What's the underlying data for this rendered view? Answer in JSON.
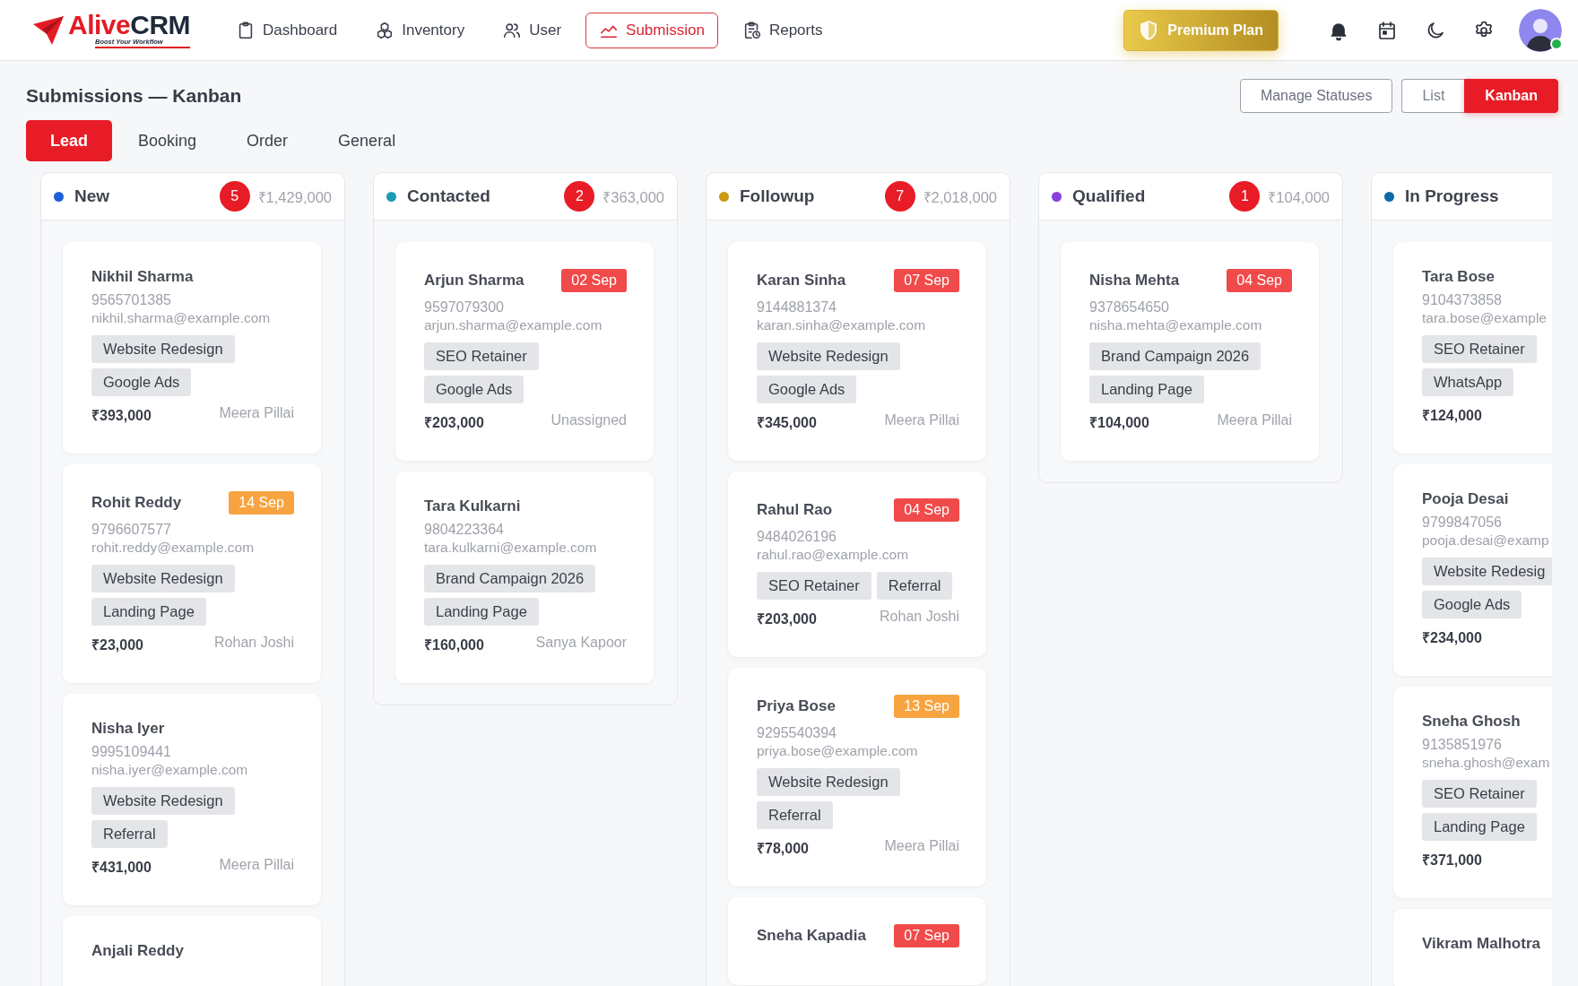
{
  "header": {
    "brand_first": "Alive",
    "brand_second": "CRM",
    "tagline": "Boost Your Workflow",
    "nav": [
      {
        "label": "Dashboard",
        "selected": false
      },
      {
        "label": "Inventory",
        "selected": false
      },
      {
        "label": "User",
        "selected": false
      },
      {
        "label": "Submission",
        "selected": true
      },
      {
        "label": "Reports",
        "selected": false
      }
    ],
    "premium": "Premium Plan",
    "user_online": true
  },
  "page": {
    "title": "Submissions — Kanban",
    "manage_button": "Manage Statuses",
    "views": [
      {
        "label": "List",
        "selected": false
      },
      {
        "label": "Kanban",
        "selected": true
      }
    ],
    "tabs": [
      {
        "label": "Lead",
        "selected": true
      },
      {
        "label": "Booking",
        "selected": false
      },
      {
        "label": "Order",
        "selected": false
      },
      {
        "label": "General",
        "selected": false
      }
    ]
  },
  "columns": [
    {
      "name": "New",
      "color": "#1f5fd8",
      "count": "5",
      "total": "₹1,429,000",
      "cards": [
        {
          "name": "Nikhil Sharma",
          "phone": "9565701385",
          "email": "nikhil.sharma@example.com",
          "tags": [
            "Website Redesign",
            "Google Ads"
          ],
          "amount": "₹393,000",
          "assignee": "Meera Pillai"
        },
        {
          "name": "Rohit Reddy",
          "due": {
            "label": "14 Sep",
            "color": "#f7a440"
          },
          "phone": "9796607577",
          "email": "rohit.reddy@example.com",
          "tags": [
            "Website Redesign",
            "Landing Page"
          ],
          "amount": "₹23,000",
          "assignee": "Rohan Joshi"
        },
        {
          "name": "Nisha Iyer",
          "phone": "9995109441",
          "email": "nisha.iyer@example.com",
          "tags": [
            "Website Redesign",
            "Referral"
          ],
          "amount": "₹431,000",
          "assignee": "Meera Pillai"
        },
        {
          "name": "Anjali Reddy"
        }
      ]
    },
    {
      "name": "Contacted",
      "color": "#1c9cb4",
      "count": "2",
      "total": "₹363,000",
      "cards": [
        {
          "name": "Arjun Sharma",
          "due": {
            "label": "02 Sep",
            "color": "#f04a4a"
          },
          "phone": "9597079300",
          "email": "arjun.sharma@example.com",
          "tags": [
            "SEO Retainer",
            "Google Ads"
          ],
          "amount": "₹203,000",
          "assignee": "Unassigned"
        },
        {
          "name": "Tara Kulkarni",
          "phone": "9804223364",
          "email": "tara.kulkarni@example.com",
          "tags": [
            "Brand Campaign 2026",
            "Landing Page"
          ],
          "amount": "₹160,000",
          "assignee": "Sanya Kapoor"
        }
      ]
    },
    {
      "name": "Followup",
      "color": "#c99a12",
      "count": "7",
      "total": "₹2,018,000",
      "cards": [
        {
          "name": "Karan Sinha",
          "due": {
            "label": "07 Sep",
            "color": "#f04a4a"
          },
          "phone": "9144881374",
          "email": "karan.sinha@example.com",
          "tags": [
            "Website Redesign",
            "Google Ads"
          ],
          "amount": "₹345,000",
          "assignee": "Meera Pillai"
        },
        {
          "name": "Rahul Rao",
          "due": {
            "label": "04 Sep",
            "color": "#f04a4a"
          },
          "phone": "9484026196",
          "email": "rahul.rao@example.com",
          "tags": [
            "SEO Retainer",
            "Referral"
          ],
          "amount": "₹203,000",
          "assignee": "Rohan Joshi"
        },
        {
          "name": "Priya Bose",
          "due": {
            "label": "13 Sep",
            "color": "#f7a440"
          },
          "phone": "9295540394",
          "email": "priya.bose@example.com",
          "tags": [
            "Website Redesign",
            "Referral"
          ],
          "amount": "₹78,000",
          "assignee": "Meera Pillai"
        },
        {
          "name": "Sneha Kapadia",
          "due": {
            "label": "07 Sep",
            "color": "#f04a4a"
          }
        }
      ]
    },
    {
      "name": "Qualified",
      "color": "#8a3fe0",
      "count": "1",
      "total": "₹104,000",
      "cards": [
        {
          "name": "Nisha Mehta",
          "due": {
            "label": "04 Sep",
            "color": "#f04a4a"
          },
          "phone": "9378654650",
          "email": "nisha.mehta@example.com",
          "tags": [
            "Brand Campaign 2026",
            "Landing Page"
          ],
          "amount": "₹104,000",
          "assignee": "Meera Pillai"
        }
      ]
    },
    {
      "name": "In Progress",
      "color": "#0e69a8",
      "cards": [
        {
          "name": "Tara Bose",
          "phone": "9104373858",
          "email": "tara.bose@example",
          "tags": [
            "SEO Retainer",
            "WhatsApp"
          ],
          "amount": "₹124,000"
        },
        {
          "name": "Pooja Desai",
          "phone": "9799847056",
          "email": "pooja.desai@examp",
          "tags": [
            "Website Redesig",
            "Google Ads"
          ],
          "amount": "₹234,000"
        },
        {
          "name": "Sneha Ghosh",
          "phone": "9135851976",
          "email": "sneha.ghosh@exam",
          "tags": [
            "SEO Retainer",
            "Landing Page"
          ],
          "amount": "₹371,000"
        },
        {
          "name": "Vikram Malhotra"
        }
      ]
    }
  ]
}
